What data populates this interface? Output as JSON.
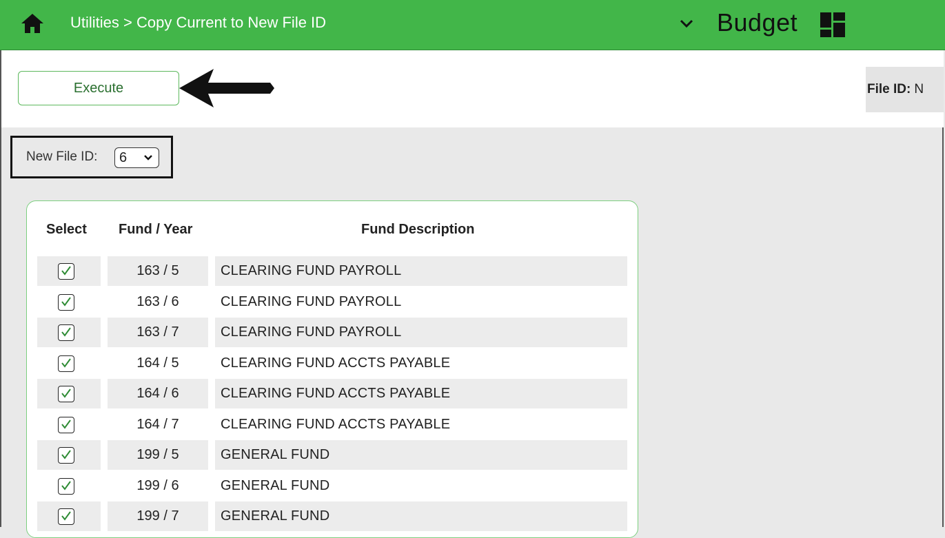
{
  "header": {
    "breadcrumb": "Utilities > Copy Current to New File ID",
    "app_title": "Budget",
    "bar_color": "#42b649"
  },
  "toolbar": {
    "execute_label": "Execute",
    "file_id_label": "File ID:",
    "file_id_value": "N"
  },
  "form": {
    "new_file_id_label": "New File ID:",
    "new_file_id_value": "6"
  },
  "table": {
    "columns": [
      "Select",
      "Fund / Year",
      "Fund Description"
    ],
    "rows": [
      {
        "checked": true,
        "fund_year": "163 / 5",
        "description": "CLEARING FUND PAYROLL"
      },
      {
        "checked": true,
        "fund_year": "163 / 6",
        "description": "CLEARING FUND PAYROLL"
      },
      {
        "checked": true,
        "fund_year": "163 / 7",
        "description": "CLEARING FUND PAYROLL"
      },
      {
        "checked": true,
        "fund_year": "164 / 5",
        "description": "CLEARING FUND ACCTS PAYABLE"
      },
      {
        "checked": true,
        "fund_year": "164 / 6",
        "description": "CLEARING FUND ACCTS PAYABLE"
      },
      {
        "checked": true,
        "fund_year": "164 / 7",
        "description": "CLEARING FUND ACCTS PAYABLE"
      },
      {
        "checked": true,
        "fund_year": "199 / 5",
        "description": "GENERAL FUND"
      },
      {
        "checked": true,
        "fund_year": "199 / 6",
        "description": "GENERAL FUND"
      },
      {
        "checked": true,
        "fund_year": "199 / 7",
        "description": "GENERAL FUND"
      }
    ]
  },
  "icons": {
    "home": "home-icon",
    "menu": "chevron-down-icon",
    "dashboard": "dashboard-icon",
    "annotation": "arrow-left-icon"
  },
  "colors": {
    "accent_green": "#42b649",
    "check_green": "#2e8b34"
  }
}
